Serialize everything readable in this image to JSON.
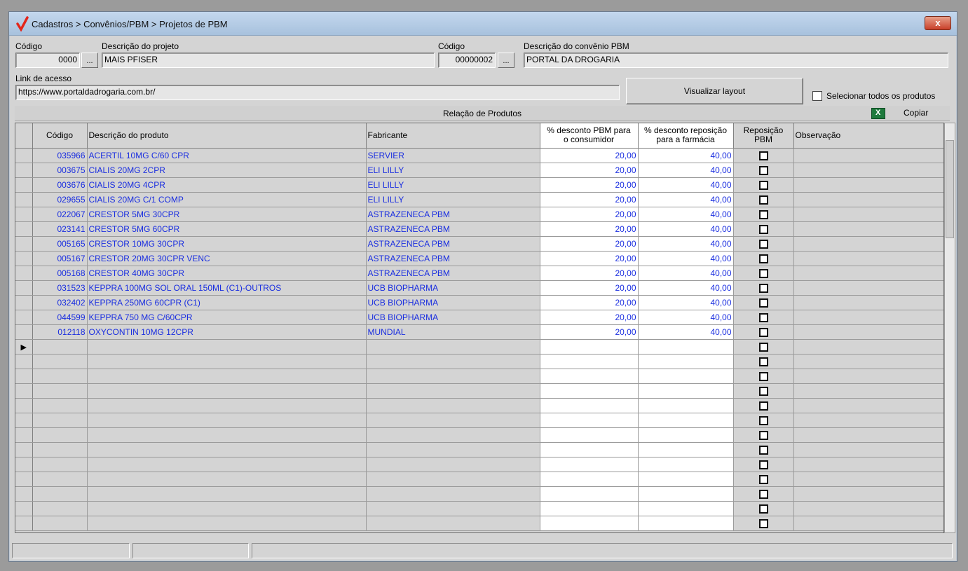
{
  "window": {
    "title": "Cadastros > Convênios/PBM > Projetos de PBM",
    "close_label": "x"
  },
  "form": {
    "codigo_label": "Código",
    "codigo_value": "0000",
    "dots_label": "...",
    "descricao_projeto_label": "Descrição do projeto",
    "descricao_projeto_value": "MAIS PFISER",
    "codigo2_label": "Código",
    "codigo2_value": "00000002",
    "descricao_convenio_label": "Descrição do convênio PBM",
    "descricao_convenio_value": "PORTAL DA DROGARIA",
    "link_label": "Link de acesso",
    "link_value": "https://www.portaldadrogaria.com.br/",
    "visualizar_label": "Visualizar layout",
    "selecionar_label": "Selecionar todos os produtos"
  },
  "products": {
    "section_title": "Relação de Produtos",
    "copy_label": "Copiar",
    "columns": {
      "codigo": "Código",
      "descricao": "Descrição do produto",
      "fabricante": "Fabricante",
      "desc_pbm_1": "% desconto PBM para",
      "desc_pbm_2": "o consumidor",
      "desc_rep_1": "% desconto reposição",
      "desc_rep_2": "para a farmácia",
      "reposicao_1": "Reposição",
      "reposicao_2": "PBM",
      "observacao": "Observação"
    },
    "rows": [
      {
        "codigo": "035966",
        "descricao": "ACERTIL 10MG C/60 CPR",
        "fabricante": "SERVIER",
        "pbm": "20,00",
        "rep": "40,00"
      },
      {
        "codigo": "003675",
        "descricao": "CIALIS 20MG 2CPR",
        "fabricante": "ELI LILLY",
        "pbm": "20,00",
        "rep": "40,00"
      },
      {
        "codigo": "003676",
        "descricao": "CIALIS 20MG 4CPR",
        "fabricante": "ELI LILLY",
        "pbm": "20,00",
        "rep": "40,00"
      },
      {
        "codigo": "029655",
        "descricao": "CIALIS 20MG C/1 COMP",
        "fabricante": "ELI LILLY",
        "pbm": "20,00",
        "rep": "40,00"
      },
      {
        "codigo": "022067",
        "descricao": "CRESTOR  5MG 30CPR",
        "fabricante": "ASTRAZENECA PBM",
        "pbm": "20,00",
        "rep": "40,00"
      },
      {
        "codigo": "023141",
        "descricao": "CRESTOR  5MG 60CPR",
        "fabricante": "ASTRAZENECA PBM",
        "pbm": "20,00",
        "rep": "40,00"
      },
      {
        "codigo": "005165",
        "descricao": "CRESTOR 10MG 30CPR",
        "fabricante": "ASTRAZENECA PBM",
        "pbm": "20,00",
        "rep": "40,00"
      },
      {
        "codigo": "005167",
        "descricao": "CRESTOR 20MG 30CPR VENC",
        "fabricante": "ASTRAZENECA PBM",
        "pbm": "20,00",
        "rep": "40,00"
      },
      {
        "codigo": "005168",
        "descricao": "CRESTOR 40MG 30CPR",
        "fabricante": "ASTRAZENECA PBM",
        "pbm": "20,00",
        "rep": "40,00"
      },
      {
        "codigo": "031523",
        "descricao": "KEPPRA 100MG SOL ORAL 150ML (C1)-OUTROS",
        "fabricante": "UCB BIOPHARMA",
        "pbm": "20,00",
        "rep": "40,00"
      },
      {
        "codigo": "032402",
        "descricao": "KEPPRA 250MG 60CPR (C1)",
        "fabricante": "UCB BIOPHARMA",
        "pbm": "20,00",
        "rep": "40,00"
      },
      {
        "codigo": "044599",
        "descricao": "KEPPRA 750 MG C/60CPR",
        "fabricante": "UCB BIOPHARMA",
        "pbm": "20,00",
        "rep": "40,00"
      },
      {
        "codigo": "012118",
        "descricao": "OXYCONTIN 10MG  12CPR",
        "fabricante": "MUNDIAL",
        "pbm": "20,00",
        "rep": "40,00"
      }
    ],
    "empty_rows": 13,
    "current_row_indicator": "▶"
  }
}
